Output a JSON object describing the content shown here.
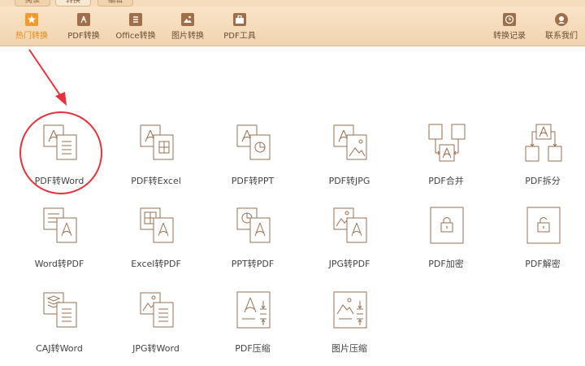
{
  "tabs": [
    {
      "label": "阅读"
    },
    {
      "label": "转换"
    },
    {
      "label": "编辑"
    }
  ],
  "toolbar": {
    "items": [
      {
        "label": "热门转换",
        "icon": "star-icon",
        "selected": true
      },
      {
        "label": "PDF转换",
        "icon": "pdf-file-icon",
        "selected": false
      },
      {
        "label": "Office转换",
        "icon": "office-doc-icon",
        "selected": false
      },
      {
        "label": "图片转换",
        "icon": "image-icon",
        "selected": false
      },
      {
        "label": "PDF工具",
        "icon": "toolbox-icon",
        "selected": false
      }
    ],
    "right_items": [
      {
        "label": "转换记录",
        "icon": "history-clock-icon"
      },
      {
        "label": "联系我们",
        "icon": "headset-icon"
      }
    ]
  },
  "grid": [
    {
      "label": "PDF转Word",
      "icon": "pdf-to-word-icon"
    },
    {
      "label": "PDF转Excel",
      "icon": "pdf-to-excel-icon"
    },
    {
      "label": "PDF转PPT",
      "icon": "pdf-to-ppt-icon"
    },
    {
      "label": "PDF转JPG",
      "icon": "pdf-to-jpg-icon"
    },
    {
      "label": "PDF合并",
      "icon": "pdf-merge-icon"
    },
    {
      "label": "PDF拆分",
      "icon": "pdf-split-icon"
    },
    {
      "label": "Word转PDF",
      "icon": "word-to-pdf-icon"
    },
    {
      "label": "Excel转PDF",
      "icon": "excel-to-pdf-icon"
    },
    {
      "label": "PPT转PDF",
      "icon": "ppt-to-pdf-icon"
    },
    {
      "label": "JPG转PDF",
      "icon": "jpg-to-pdf-icon"
    },
    {
      "label": "PDF加密",
      "icon": "pdf-encrypt-icon"
    },
    {
      "label": "PDF解密",
      "icon": "pdf-decrypt-icon"
    },
    {
      "label": "CAJ转Word",
      "icon": "caj-to-word-icon"
    },
    {
      "label": "JPG转Word",
      "icon": "jpg-to-word-icon"
    },
    {
      "label": "PDF压缩",
      "icon": "pdf-compress-icon"
    },
    {
      "label": "图片压缩",
      "icon": "image-compress-icon"
    }
  ],
  "colors": {
    "accent": "#e8891a",
    "icon_stroke": "#9a7152",
    "highlight_circle": "#e8313a"
  }
}
